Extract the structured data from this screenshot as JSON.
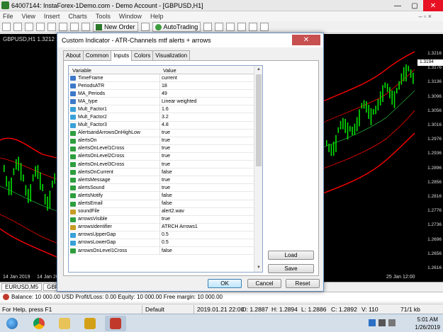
{
  "window": {
    "title": "64007144: InstaForex-1Demo.com - Demo Account - [GBPUSD,H1]",
    "min": "—",
    "max": "▢",
    "close": "✕"
  },
  "menu": [
    "File",
    "View",
    "Insert",
    "Charts",
    "Tools",
    "Window",
    "Help"
  ],
  "menu_mdi": "– ▫ ×",
  "toolbar": {
    "new_order": "New Order",
    "autotrading": "AutoTrading"
  },
  "chart": {
    "symbol_label": "GBPUSD,H1  1.3212 1.32",
    "price_tag": "1.3194",
    "price_axis": [
      "1.3216",
      "1.3176",
      "1.3136",
      "1.3096",
      "1.3056",
      "1.3016",
      "1.2976",
      "1.2936",
      "1.2896",
      "1.2856",
      "1.2816",
      "1.2776",
      "1.2736",
      "1.2696",
      "1.2656",
      "1.2616"
    ],
    "date_labels": [
      "14 Jan 2019",
      "14 Jan 20:00",
      "25 Jan 12:00"
    ],
    "colors": {
      "upper_band": "#ff0000",
      "lower_band": "#ff0000",
      "mid_band": "#1f9e2f",
      "candles": "#00e000"
    }
  },
  "chart_tabs": [
    "EURUSD,M5",
    "GBPU"
  ],
  "terminal": {
    "text": "Balance: 10 000.00 USD  Profit/Loss: 0.00  Equity: 10 000.00  Free margin: 10 000.00"
  },
  "status": {
    "help": "For Help, press F1",
    "profile": "Default",
    "datetime": "2019.01.21 22:00",
    "open": "O: 1.2887",
    "high": "H: 1.2894",
    "low": "L: 1.2886",
    "close": "C: 1.2892",
    "volume": "V: 110",
    "traffic": "71/1 kb"
  },
  "taskbar": {
    "time": "5:01 AM",
    "date": "1/26/2019"
  },
  "dialog": {
    "title": "Custom Indicator - ATR-Channels mtf alerts + arrows",
    "close": "✕",
    "tabs": [
      "About",
      "Common",
      "Inputs",
      "Colors",
      "Visualization"
    ],
    "table_header": {
      "variable": "Variable",
      "value": "Value"
    },
    "params": [
      {
        "name": "TimeFrame",
        "value": "current",
        "type": "t-abc",
        "tag": "123"
      },
      {
        "name": "PeriodsATR",
        "value": "18",
        "type": "t-num",
        "tag": "123"
      },
      {
        "name": "MA_Periods",
        "value": "49",
        "type": "t-num",
        "tag": "123"
      },
      {
        "name": "MA_type",
        "value": "Linear weighted",
        "type": "t-abc",
        "tag": "123"
      },
      {
        "name": "Mult_Factor1",
        "value": "1.6",
        "type": "t-dbl",
        "tag": "½"
      },
      {
        "name": "Mult_Factor2",
        "value": "3.2",
        "type": "t-dbl",
        "tag": "½"
      },
      {
        "name": "Mult_Factor3",
        "value": "4.8",
        "type": "t-dbl",
        "tag": "½"
      },
      {
        "name": "AlertsandArrowsOnHighLow",
        "value": "true",
        "type": "t-bool",
        "tag": "✓"
      },
      {
        "name": "alertsOn",
        "value": "true",
        "type": "t-bool",
        "tag": "✓"
      },
      {
        "name": "alertsOnLevel1Cross",
        "value": "true",
        "type": "t-bool",
        "tag": "✓"
      },
      {
        "name": "alertsOnLevel2Cross",
        "value": "true",
        "type": "t-bool",
        "tag": "✓"
      },
      {
        "name": "alertsOnLevel3Cross",
        "value": "true",
        "type": "t-bool",
        "tag": "✓"
      },
      {
        "name": "alertsOnCurrent",
        "value": "false",
        "type": "t-bool",
        "tag": "✓"
      },
      {
        "name": "alertsMessage",
        "value": "true",
        "type": "t-bool",
        "tag": "✓"
      },
      {
        "name": "alertsSound",
        "value": "true",
        "type": "t-bool",
        "tag": "✓"
      },
      {
        "name": "alertsNotify",
        "value": "false",
        "type": "t-bool",
        "tag": "✓"
      },
      {
        "name": "alertsEmail",
        "value": "false",
        "type": "t-bool",
        "tag": "✓"
      },
      {
        "name": "soundFile",
        "value": "alert2.wav",
        "type": "t-str",
        "tag": "ab"
      },
      {
        "name": "arrowsVisible",
        "value": "true",
        "type": "t-bool",
        "tag": "✓"
      },
      {
        "name": "arrowsIdentifier",
        "value": "ATRCH Arrows1",
        "type": "t-str",
        "tag": "ab"
      },
      {
        "name": "arrowsUpperGap",
        "value": "0.5",
        "type": "t-dbl",
        "tag": "½"
      },
      {
        "name": "arrowsLowerGap",
        "value": "0.5",
        "type": "t-dbl",
        "tag": "½"
      },
      {
        "name": "arrowsOnLevel1Cross",
        "value": "false",
        "type": "t-bool",
        "tag": "✓"
      }
    ],
    "buttons": {
      "load": "Load",
      "save": "Save",
      "ok": "OK",
      "cancel": "Cancel",
      "reset": "Reset"
    }
  }
}
